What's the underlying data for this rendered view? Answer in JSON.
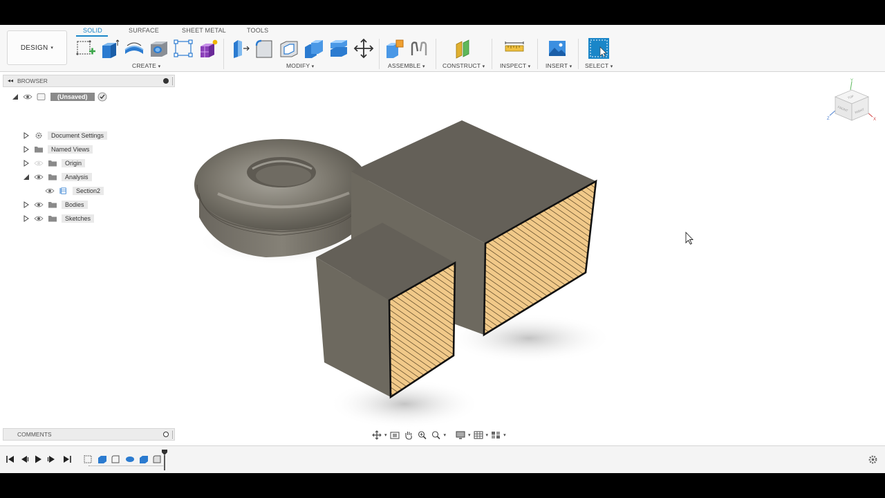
{
  "ribbon": {
    "workspace": "DESIGN",
    "tabs": [
      "SOLID",
      "SURFACE",
      "SHEET METAL",
      "TOOLS"
    ],
    "groups": {
      "create": "CREATE",
      "modify": "MODIFY",
      "assemble": "ASSEMBLE",
      "construct": "CONSTRUCT",
      "inspect": "INSPECT",
      "insert": "INSERT",
      "select": "SELECT"
    },
    "caret": "▾"
  },
  "browser": {
    "title": "BROWSER",
    "root": "(Unsaved)",
    "items": {
      "document_settings": "Document Settings",
      "named_views": "Named Views",
      "origin": "Origin",
      "analysis": "Analysis",
      "section": "Section2",
      "bodies": "Bodies",
      "sketches": "Sketches"
    }
  },
  "comments": {
    "title": "COMMENTS"
  },
  "viewcube": {
    "top": "TOP",
    "front": "FRONT",
    "right": "RIGHT",
    "x": "X",
    "y": "Y",
    "z": "Z"
  },
  "colors": {
    "accent": "#1a86c8",
    "body_fill": "#6e6a60",
    "section_fill": "#f1c989",
    "hatch": "#3a2a10"
  }
}
